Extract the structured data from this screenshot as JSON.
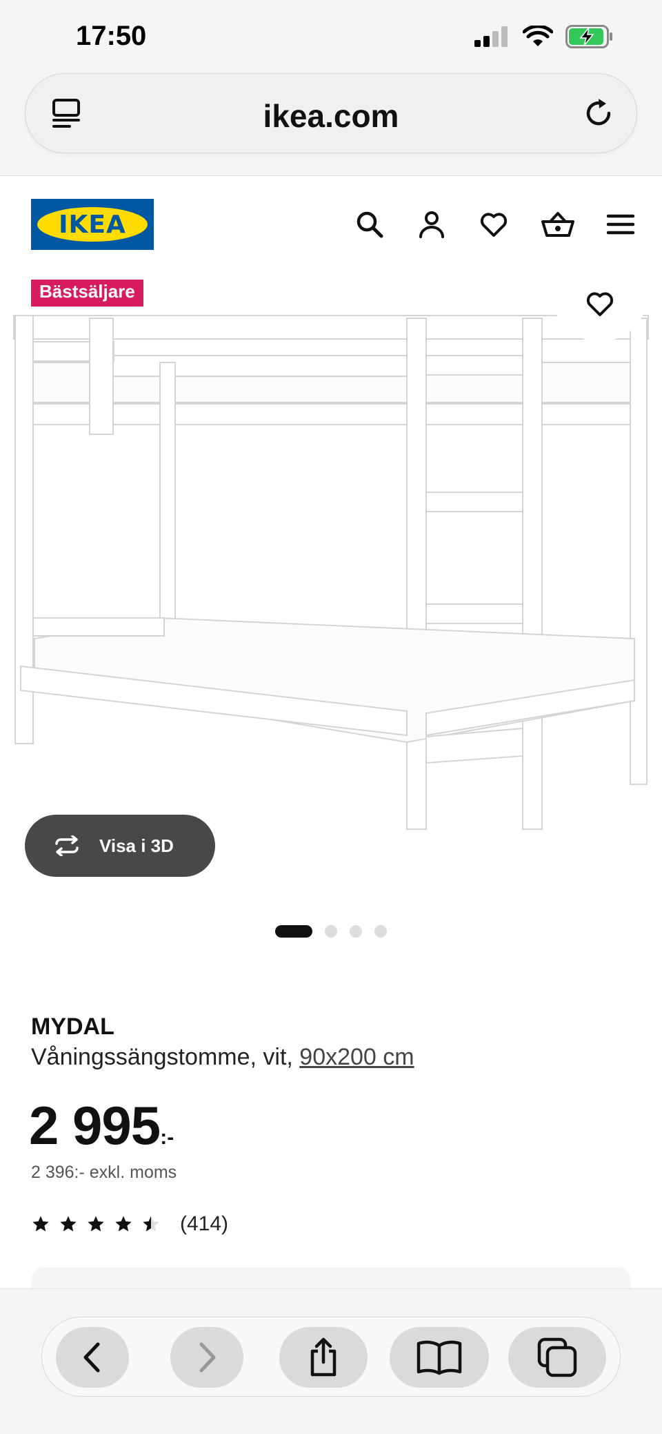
{
  "status": {
    "time": "17:50"
  },
  "browser": {
    "url": "ikea.com"
  },
  "site": {
    "logo_text": "IKEA"
  },
  "product": {
    "badge": "Bästsäljare",
    "view3d_label": "Visa i 3D",
    "name": "MYDAL",
    "description": "Våningssängstomme, vit,",
    "size_link": "90x200 cm",
    "price_main": "2 995",
    "price_suffix": ":-",
    "price_ex_vat": "2 396:- exkl. moms",
    "rating_value": 4.5,
    "rating_count": "(414)",
    "image_count": 4,
    "image_active": 1
  },
  "colors": {
    "ikea_blue": "#0058a3",
    "ikea_yellow": "#ffdb00",
    "badge_pink": "#d81b60",
    "battery_green": "#34c759"
  }
}
